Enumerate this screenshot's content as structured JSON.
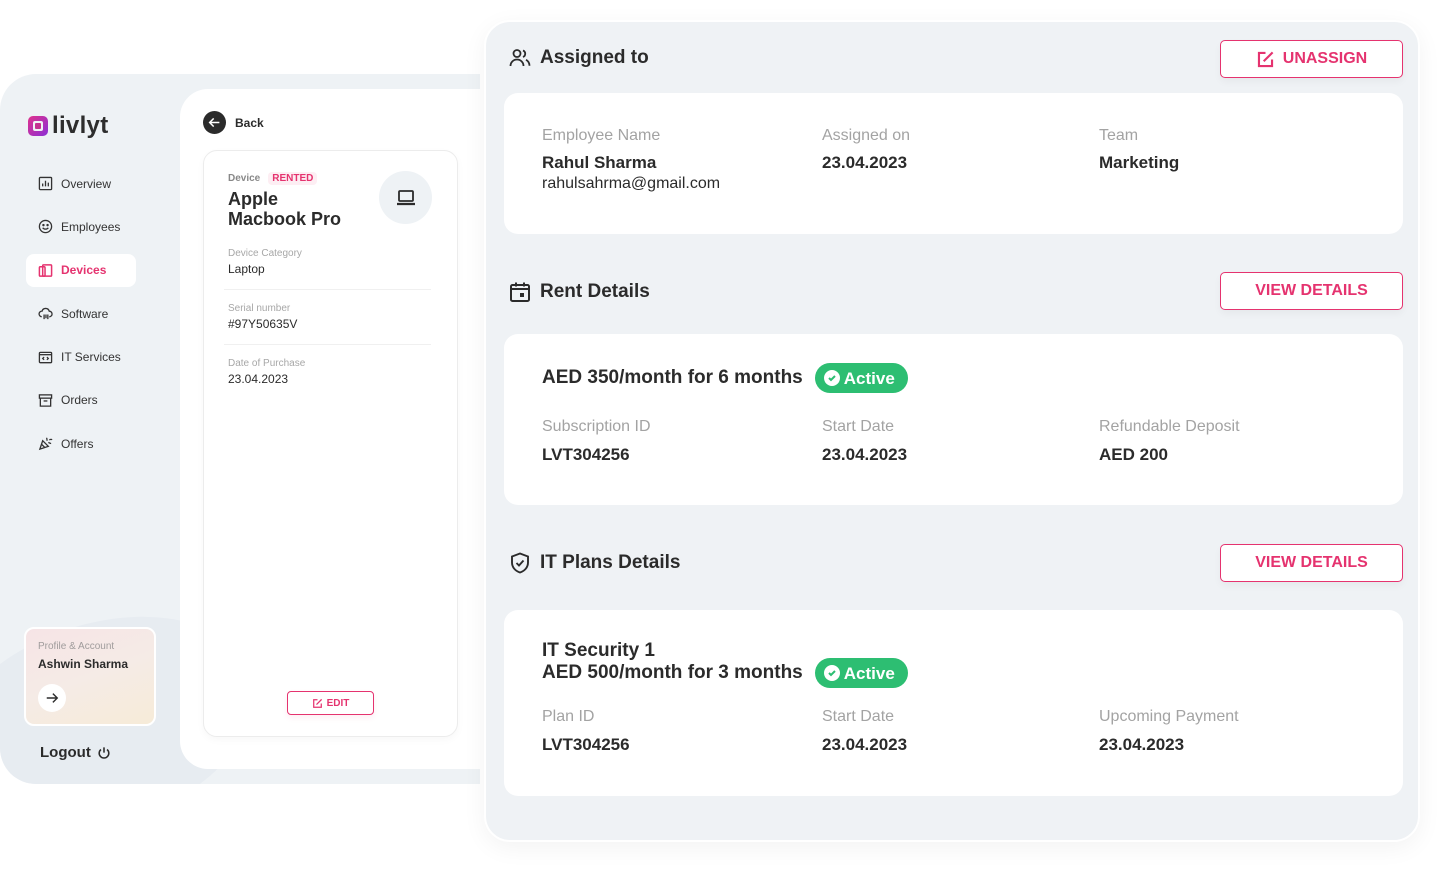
{
  "brand": {
    "name": "livlyt",
    "accent": "#e5336f",
    "success": "#2dbe72"
  },
  "sidebar": {
    "items": [
      {
        "label": "Overview",
        "icon": "chart-icon",
        "active": false
      },
      {
        "label": "Employees",
        "icon": "smiley-icon",
        "active": false
      },
      {
        "label": "Devices",
        "icon": "devices-icon",
        "active": true
      },
      {
        "label": "Software",
        "icon": "cloud-icon",
        "active": false
      },
      {
        "label": "IT Services",
        "icon": "code-window-icon",
        "active": false
      },
      {
        "label": "Orders",
        "icon": "archive-icon",
        "active": false
      },
      {
        "label": "Offers",
        "icon": "party-popper-icon",
        "active": false
      }
    ],
    "profile": {
      "label": "Profile & Account",
      "name": "Ashwin Sharma"
    },
    "logout_label": "Logout"
  },
  "device": {
    "back_label": "Back",
    "tag_label": "Device",
    "status_badge": "RENTED",
    "name_line1": "Apple",
    "name_line2": "Macbook Pro",
    "fields": [
      {
        "label": "Device Category",
        "value": "Laptop"
      },
      {
        "label": "Serial number",
        "value": "#97Y50635V"
      },
      {
        "label": "Date of Purchase",
        "value": "23.04.2023"
      }
    ],
    "edit_label": "EDIT"
  },
  "assigned": {
    "title": "Assigned to",
    "action_label": "UNASSIGN",
    "employee_label": "Employee Name",
    "employee_name": "Rahul Sharma",
    "employee_email": "rahulsahrma@gmail.com",
    "assigned_on_label": "Assigned on",
    "assigned_on": "23.04.2023",
    "team_label": "Team",
    "team": "Marketing"
  },
  "rent": {
    "title": "Rent Details",
    "action_label": "VIEW DETAILS",
    "plan": "AED 350/month for 6 months",
    "status": "Active",
    "fields": [
      {
        "label": "Subscription ID",
        "value": "LVT304256"
      },
      {
        "label": "Start Date",
        "value": "23.04.2023"
      },
      {
        "label": "Refundable Deposit",
        "value": "AED 200"
      }
    ]
  },
  "it_plans": {
    "title": "IT Plans Details",
    "action_label": "VIEW DETAILS",
    "plan_name": "IT Security 1",
    "plan": "AED 500/month for 3 months",
    "status": "Active",
    "fields": [
      {
        "label": "Plan ID",
        "value": "LVT304256"
      },
      {
        "label": "Start Date",
        "value": "23.04.2023"
      },
      {
        "label": "Upcoming Payment",
        "value": "23.04.2023"
      }
    ]
  }
}
